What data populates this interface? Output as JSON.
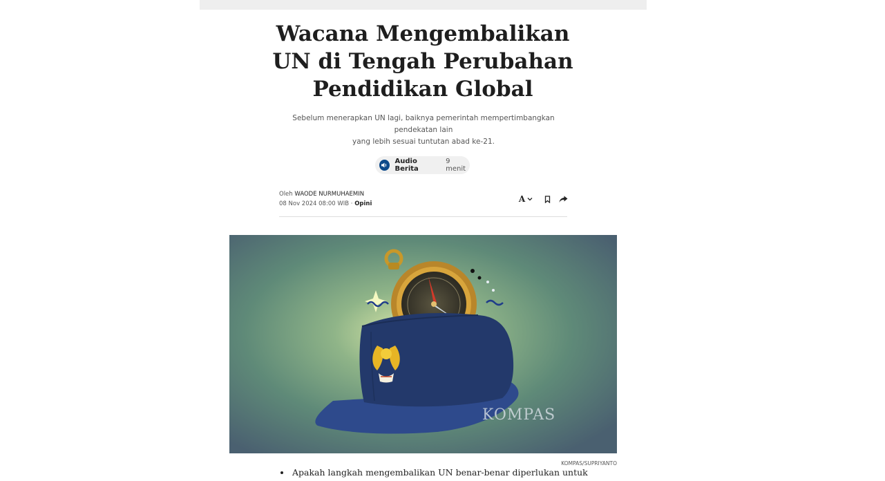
{
  "article": {
    "title_line1": "Wacana Mengembalikan",
    "title_line2": "UN di Tengah Perubahan",
    "title_line3": "Pendidikan Global",
    "subtitle_line1": "Sebelum menerapkan UN lagi, baiknya pemerintah mempertimbangkan pendekatan lain",
    "subtitle_line2": "yang lebih sesuai tuntutan abad ke-21."
  },
  "audio": {
    "label": "Audio Berita",
    "duration": "9 menit",
    "icon": "speaker-icon"
  },
  "byline": {
    "prefix": "Oleh",
    "author": "WAODE NURMUHAEMIN",
    "date": "08 Nov 2024 08:00 WIB",
    "separator": "·",
    "category": "Opini"
  },
  "tools": {
    "font_glyph": "A",
    "icons": [
      "font-size-icon",
      "chevron-down-icon",
      "bookmark-icon",
      "share-icon"
    ]
  },
  "image": {
    "watermark": "KOMPAS",
    "credit": "KOMPAS/SUPRIYANTO"
  },
  "bullets": [
    "Apakah langkah mengembalikan UN benar-benar diperlukan untuk"
  ],
  "colors": {
    "audio_icon_bg": "#0e4a8a",
    "pill_bg": "#f0f0f0",
    "hat_blue": "#23396b",
    "image_bg": "#5f8a78"
  }
}
